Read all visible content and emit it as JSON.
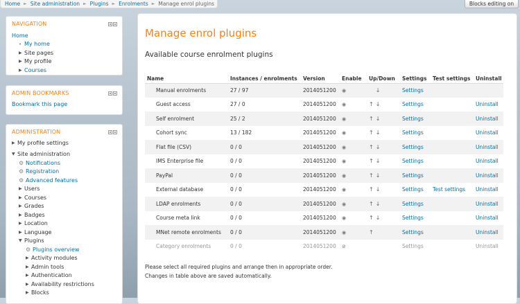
{
  "breadcrumb": {
    "items": [
      "Home",
      "Site administration",
      "Plugins",
      "Enrolments",
      "Manage enrol plugins"
    ]
  },
  "blocks_editing_button": "Blocks editing on",
  "navigation": {
    "title": "NAVIGATION",
    "home": "Home",
    "items": [
      "My home",
      "Site pages",
      "My profile",
      "Courses"
    ]
  },
  "admin_bookmarks": {
    "title": "ADMIN BOOKMARKS",
    "link": "Bookmark this page"
  },
  "administration": {
    "title": "ADMINISTRATION",
    "my_profile_settings": "My profile settings",
    "site_administration": "Site administration",
    "gear_items": [
      "Notifications",
      "Registration",
      "Advanced features"
    ],
    "folders": [
      "Users",
      "Courses",
      "Grades",
      "Badges",
      "Location",
      "Language"
    ],
    "plugins": "Plugins",
    "plugins_overview": "Plugins overview",
    "plugin_folders": [
      "Activity modules",
      "Admin tools",
      "Authentication",
      "Availability restrictions",
      "Blocks"
    ]
  },
  "main": {
    "title": "Manage enrol plugins",
    "section_title": "Available course enrolment plugins",
    "columns": [
      "Name",
      "Instances / enrolments",
      "Version",
      "Enable",
      "Up/Down",
      "Settings",
      "Test settings",
      "Uninstall"
    ],
    "rows": [
      {
        "name": "Manual enrolments",
        "instances": "27 / 97",
        "version": "2014051200",
        "enable": "eye",
        "up": false,
        "down": true,
        "settings": "Settings",
        "test": "",
        "uninstall": "",
        "dimmed": false
      },
      {
        "name": "Guest access",
        "instances": "27 / 0",
        "version": "2014051200",
        "enable": "eye",
        "up": true,
        "down": true,
        "settings": "Settings",
        "test": "",
        "uninstall": "Uninstall",
        "dimmed": false
      },
      {
        "name": "Self enrolment",
        "instances": "25 / 2",
        "version": "2014051200",
        "enable": "eye",
        "up": true,
        "down": true,
        "settings": "Settings",
        "test": "",
        "uninstall": "Uninstall",
        "dimmed": false
      },
      {
        "name": "Cohort sync",
        "instances": "13 / 182",
        "version": "2014051200",
        "enable": "eye",
        "up": true,
        "down": true,
        "settings": "Settings",
        "test": "",
        "uninstall": "Uninstall",
        "dimmed": false
      },
      {
        "name": "Flat file (CSV)",
        "instances": "0 / 0",
        "version": "2014051200",
        "enable": "eye",
        "up": true,
        "down": true,
        "settings": "Settings",
        "test": "",
        "uninstall": "Uninstall",
        "dimmed": false
      },
      {
        "name": "IMS Enterprise file",
        "instances": "0 / 0",
        "version": "2014051200",
        "enable": "eye",
        "up": true,
        "down": true,
        "settings": "Settings",
        "test": "",
        "uninstall": "Uninstall",
        "dimmed": false
      },
      {
        "name": "PayPal",
        "instances": "0 / 0",
        "version": "2014051200",
        "enable": "eye",
        "up": true,
        "down": true,
        "settings": "Settings",
        "test": "",
        "uninstall": "Uninstall",
        "dimmed": false
      },
      {
        "name": "External database",
        "instances": "0 / 0",
        "version": "2014051200",
        "enable": "eye",
        "up": true,
        "down": true,
        "settings": "Settings",
        "test": "Test settings",
        "uninstall": "Uninstall",
        "dimmed": false
      },
      {
        "name": "LDAP enrolments",
        "instances": "0 / 0",
        "version": "2014051200",
        "enable": "eye",
        "up": true,
        "down": true,
        "settings": "Settings",
        "test": "",
        "uninstall": "Uninstall",
        "dimmed": false
      },
      {
        "name": "Course meta link",
        "instances": "0 / 0",
        "version": "2014051200",
        "enable": "eye",
        "up": true,
        "down": true,
        "settings": "Settings",
        "test": "",
        "uninstall": "Uninstall",
        "dimmed": false
      },
      {
        "name": "MNet remote enrolments",
        "instances": "0 / 0",
        "version": "2014051200",
        "enable": "eye",
        "up": true,
        "down": false,
        "settings": "Settings",
        "test": "",
        "uninstall": "Uninstall",
        "dimmed": false
      },
      {
        "name": "Category enrolments",
        "instances": "0 / 0",
        "version": "2014051200",
        "enable": "eye-closed",
        "up": false,
        "down": false,
        "settings": "Settings",
        "test": "",
        "uninstall": "Uninstall",
        "dimmed": true
      }
    ],
    "note1": "Please select all required plugins and arrange then in appropriate order.",
    "note2": "Changes in table above are saved automatically."
  }
}
